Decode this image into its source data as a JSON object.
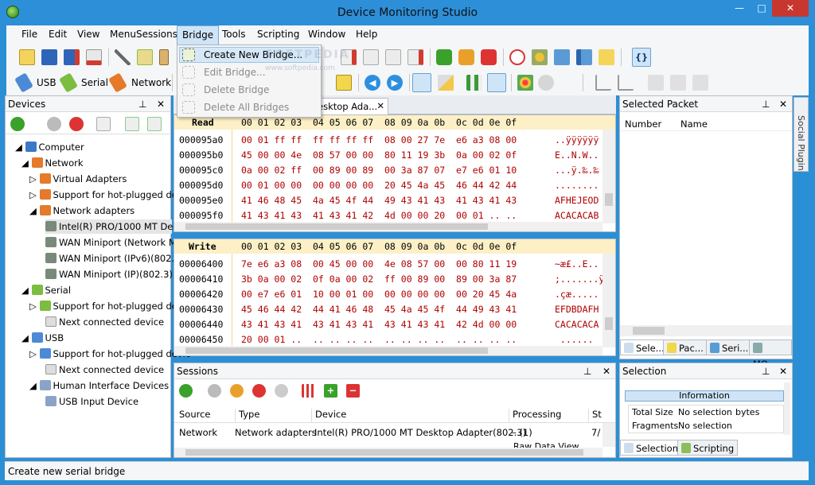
{
  "window": {
    "title": "Device Monitoring Studio",
    "minimize": "—",
    "maximize": "□",
    "close": "✕"
  },
  "menu": [
    "File",
    "Edit",
    "View",
    "MenuSessions",
    "Bridge",
    "Tools",
    "Scripting",
    "Window",
    "Help"
  ],
  "bridge_menu": {
    "items": [
      "Create New Bridge...",
      "Edit Bridge...",
      "Delete Bridge",
      "Delete All Bridges"
    ],
    "watermark": "SOFTPEDIA",
    "watermark_url": "www.softpedia.com"
  },
  "toolbar2": {
    "usb": "USB",
    "serial": "Serial",
    "network": "Network"
  },
  "devices": {
    "title": "Devices",
    "tree": [
      "Computer",
      "Network",
      "Virtual Adapters",
      "Support for hot-plugged devic",
      "Network adapters",
      "Intel(R) PRO/1000 MT Desk",
      "WAN Miniport (Network Mor",
      "WAN Miniport (IPv6)(802.3)",
      "WAN Miniport (IP)(802.3)",
      "Serial",
      "Support for hot-plugged devic",
      "Next connected device",
      "USB",
      "Support for hot-plugged devic",
      "Next connected device",
      "Human Interface Devices",
      "USB Input Device"
    ]
  },
  "doc_tab": "esktop Ada...",
  "read": {
    "label": "Read",
    "header": "00 01 02 03  04 05 06 07  08 09 0a 0b  0c 0d 0e 0f",
    "rows": [
      {
        "addr": "000095a0",
        "bytes": "00 01 ff ff  ff ff ff ff  08 00 27 7e  e6 a3 08 00",
        "ascii": "..ÿÿÿÿÿÿ"
      },
      {
        "addr": "000095b0",
        "bytes": "45 00 00 4e  08 57 00 00  80 11 19 3b  0a 00 02 0f",
        "ascii": "E..N.W.."
      },
      {
        "addr": "000095c0",
        "bytes": "0a 00 02 ff  00 89 00 89  00 3a 87 07  e7 e6 01 10",
        "ascii": "...ÿ.‰.‰"
      },
      {
        "addr": "000095d0",
        "bytes": "00 01 00 00  00 00 00 00  20 45 4a 45  46 44 42 44",
        "ascii": "........"
      },
      {
        "addr": "000095e0",
        "bytes": "41 46 48 45  4a 45 4f 44  49 43 41 43  41 43 41 43",
        "ascii": "AFHEJEOD"
      },
      {
        "addr": "000095f0",
        "bytes": "41 43 41 43  41 43 41 42  4d 00 00 20  00 01 .. ..",
        "ascii": "ACACACAB"
      }
    ]
  },
  "write": {
    "label": "Write",
    "header": "00 01 02 03  04 05 06 07  08 09 0a 0b  0c 0d 0e 0f",
    "rows": [
      {
        "addr": "00006400",
        "bytes": "7e e6 a3 08  00 45 00 00  4e 08 57 00  00 80 11 19",
        "ascii": "~æ£..E.."
      },
      {
        "addr": "00006410",
        "bytes": "3b 0a 00 02  0f 0a 00 02  ff 00 89 00  89 00 3a 87",
        "ascii": ";.......ÿ"
      },
      {
        "addr": "00006420",
        "bytes": "00 e7 e6 01  10 00 01 00  00 00 00 00  00 20 45 4a",
        "ascii": ".çæ....."
      },
      {
        "addr": "00006430",
        "bytes": "45 46 44 42  44 41 46 48  45 4a 45 4f  44 49 43 41",
        "ascii": "EFDBDAFH"
      },
      {
        "addr": "00006440",
        "bytes": "43 41 43 41  43 41 43 41  43 41 43 41  42 4d 00 00",
        "ascii": "CACACACA"
      },
      {
        "addr": "00006450",
        "bytes": "20 00 01 ..  .. .. .. ..  .. .. .. ..  .. .. .. ..",
        "ascii": " ......"
      }
    ]
  },
  "selected_packet": {
    "title": "Selected Packet",
    "col_number": "Number",
    "col_name": "Name",
    "tabs": [
      "Sele...",
      "Pac...",
      "Seri...",
      "MO..."
    ],
    "side_tab": "Social Plugin"
  },
  "sessions": {
    "title": "Sessions",
    "columns": [
      "Source",
      "Type",
      "Device",
      "Processing",
      "St"
    ],
    "row": {
      "source": "Network",
      "type": "Network adapters",
      "device": "Intel(R) PRO/1000 MT Desktop Adapter(802.3)",
      "processing": "– (1)",
      "status": "7/"
    },
    "sub": "Raw Data View"
  },
  "selection": {
    "title": "Selection",
    "info": "Information",
    "total_size_label": "Total Size",
    "total_size_value": "No selection",
    "bytes": "bytes",
    "fragments_label": "Fragments",
    "fragments_value": "No selection",
    "tabs": [
      "Selection",
      "Scripting"
    ]
  },
  "status": "Create new serial bridge"
}
